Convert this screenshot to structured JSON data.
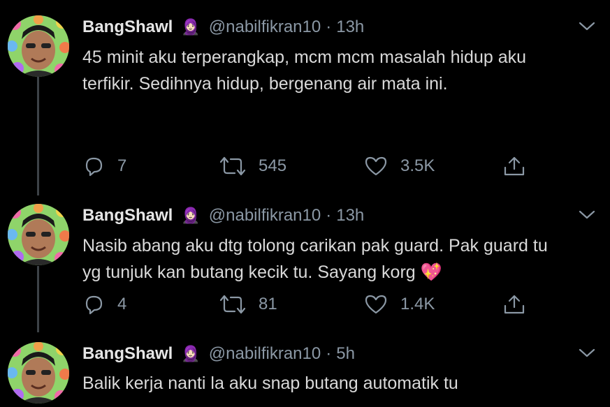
{
  "colors": {
    "background": "#000000",
    "text": "#d9d9d9",
    "muted": "#8b98a5",
    "thread_line": "#3d4247"
  },
  "tweets": [
    {
      "name": "BangShawl",
      "badge": "🧕🏻",
      "handle": "@nabilfikran10",
      "separator": "·",
      "time": "13h",
      "text_lines": [
        "45 minit aku terperangkap, mcm mcm masalah hidup aku",
        "terfikir. Sedihnya hidup, bergenang air mata ini."
      ],
      "replies": "7",
      "retweets": "545",
      "likes": "3.5K"
    },
    {
      "name": "BangShawl",
      "badge": "🧕🏻",
      "handle": "@nabilfikran10",
      "separator": "·",
      "time": "13h",
      "text_lines": [
        "Nasib abang aku dtg tolong carikan pak guard. Pak guard tu",
        "yg tunjuk kan butang kecik tu. Sayang korg 💖"
      ],
      "replies": "4",
      "retweets": "81",
      "likes": "1.4K"
    },
    {
      "name": "BangShawl",
      "badge": "🧕🏻",
      "handle": "@nabilfikran10",
      "separator": "·",
      "time": "5h",
      "text_lines": [
        "Balik kerja nanti la aku snap butang automatik tu"
      ]
    }
  ]
}
